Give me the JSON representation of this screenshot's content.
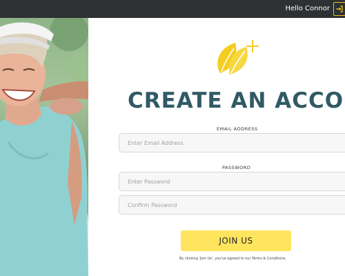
{
  "header": {
    "greeting": "Hello Connor",
    "login_icon": "sign-in-icon",
    "accent_color": "#f2c21b",
    "background_color": "#2e3134"
  },
  "hero_image": {
    "subject": "smiling-senior-woman-photo"
  },
  "logo": {
    "icon": "leaf-plus-logo-icon",
    "color": "#f5cd1f"
  },
  "form": {
    "title": "CREATE AN ACCOUNT",
    "title_color": "#315a66",
    "email": {
      "label": "EMAIL ADDRESS",
      "placeholder": "Enter Email Address",
      "value": ""
    },
    "password": {
      "label": "PASSWORD",
      "placeholder": "Enter Password",
      "value": ""
    },
    "confirm_password": {
      "placeholder": "Confirm Password",
      "value": ""
    },
    "submit_label": "JOIN US",
    "submit_color": "#ffe55e",
    "terms_text": "By clicking 'Join Us', you've agreed to our Terms & Conditions."
  }
}
